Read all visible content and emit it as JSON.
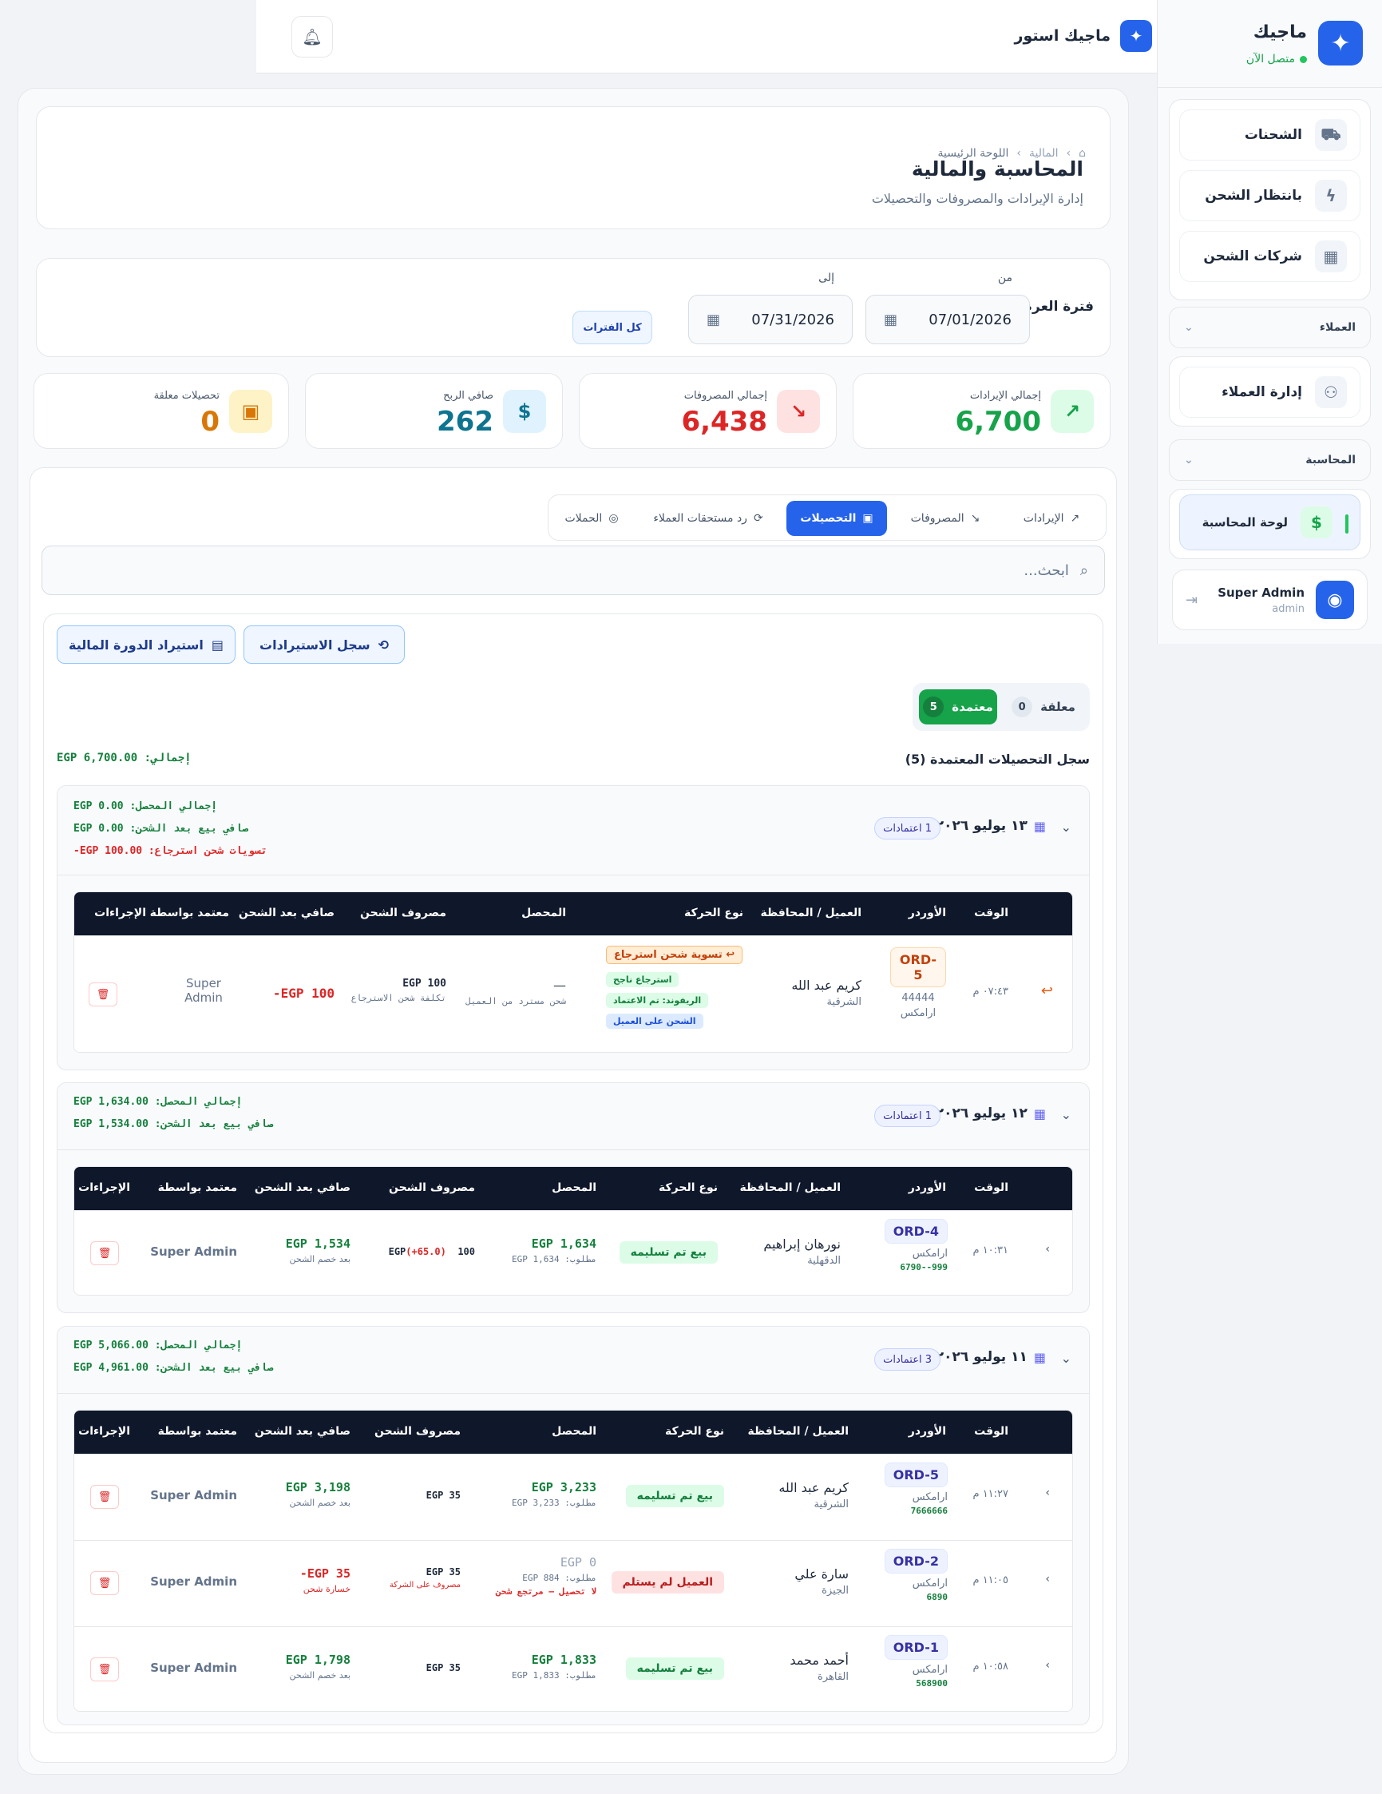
{
  "sidebar": {
    "brand": {
      "name": "ماجيك",
      "status": "متصل الآن"
    },
    "items": {
      "shipments": "الشحنات",
      "pending": "بانتظار الشحن",
      "carriers": "شركات الشحن",
      "clients_section": "العملاء",
      "clients_mgmt": "إدارة العملاء",
      "accounting_section": "المحاسبة",
      "accounting_dashboard": "لوحة المحاسبة"
    },
    "user": {
      "name": "Super Admin",
      "role": "admin"
    }
  },
  "topbar": {
    "store_name": "ماجيك استور"
  },
  "header": {
    "breadcrumb": {
      "home": "اللوحة الرئيسية",
      "current": "المالية"
    },
    "title": "المحاسبة والمالية",
    "subtitle": "إدارة الإيرادات والمصروفات والتحصيلات"
  },
  "filter": {
    "label": "فترة العرض",
    "from_label": "من",
    "to_label": "إلى",
    "from_value": "07/01/2026",
    "to_value": "07/31/2026",
    "all_button": "كل الفترات"
  },
  "stats": {
    "revenue": {
      "label": "إجمالي الإيرادات",
      "value": "6,700",
      "color": "#16a34a"
    },
    "expenses": {
      "label": "إجمالي المصروفات",
      "value": "6,438",
      "color": "#dc2626"
    },
    "profit": {
      "label": "صافي الربح",
      "value": "262",
      "color": "#0e7490"
    },
    "pending": {
      "label": "تحصيلات معلقة",
      "value": "0",
      "color": "#d97706"
    }
  },
  "tabs": {
    "revenues": "الإيرادات",
    "expenses": "المصروفات",
    "collections": "التحصيلات",
    "refunds": "رد مستحقات العملاء",
    "campaigns": "الحملات"
  },
  "search": {
    "placeholder": "ابحث..."
  },
  "collections": {
    "import_cycle": "استيراد الدورة المالية",
    "import_log": "سجل الاستيرادات",
    "seg_approved": "معتمدة",
    "seg_approved_count": "5",
    "seg_pending": "معلقة",
    "seg_pending_count": "0",
    "log_title": "سجل التحصيلات المعتمدة (5)",
    "log_total": "إجمالي: EGP 6,700.00"
  },
  "columns": {
    "time": "الوقت",
    "order": "الأوردر",
    "client": "العميل / المحافظة",
    "type": "نوع الحركة",
    "collected": "المحصل",
    "shipping": "مصروف الشحن",
    "net": "صافي بعد الشحن",
    "approved_by": "معتمد بواسطة",
    "actions": "الإجراءات"
  },
  "days": [
    {
      "date": "١٣ يوليو ٢٠٢٦",
      "badge": "1 اعتمادات",
      "sum1": "إجمالي المحصل: EGP 0.00",
      "sum2": "صافي بيع بعد الشحن: EGP 0.00",
      "sum3": "تسويات شحن استرجاع: EGP 100.00-",
      "rows": [
        {
          "time": "٠٧:٤٣ م",
          "order": "ORD-5",
          "ref": "44444",
          "carrier": "ارامكس",
          "client": "كريم عبد الله",
          "gov": "الشرقية",
          "type_main": "↩ تسوية شحن استرجاع",
          "tag1": "استرجاع ناجح",
          "tag2": "الريفوند: تم الاعتماد",
          "tag3": "الشحن على العميل",
          "collected": "—",
          "collected_sub": "شحن مسترد من العميل",
          "shipping": "EGP 100",
          "shipping_sub": "تكلفة شحن الاسترجاع",
          "net": "EGP 100-",
          "approved_by": "Super Admin"
        }
      ]
    },
    {
      "date": "١٢ يوليو ٢٠٢٦",
      "badge": "1 اعتمادات",
      "sum1": "إجمالي المحصل: EGP 1,634.00",
      "sum2": "صافي بيع بعد الشحن: EGP 1,534.00",
      "rows": [
        {
          "time": "١٠:٣١ م",
          "order": "ORD-4",
          "carrier": "ارامكس",
          "ref": "6790--999",
          "client": "نورهان إبراهيم",
          "gov": "الدقهلية",
          "type": "بيع تم تسليمه",
          "collected": "EGP 1,634",
          "collected_sub": "مطلوب: EGP 1,634",
          "shipping": "100",
          "shipping_extra": "(+65.0)",
          "shipping_cur": "EGP",
          "net": "EGP 1,534",
          "net_sub": "بعد خصم الشحن",
          "approved_by": "Super Admin"
        }
      ]
    },
    {
      "date": "١١ يوليو ٢٠٢٦",
      "badge": "3 اعتمادات",
      "sum1": "إجمالي المحصل: EGP 5,066.00",
      "sum2": "صافي بيع بعد الشحن: EGP 4,961.00",
      "rows": [
        {
          "time": "١١:٢٧ م",
          "order": "ORD-5",
          "carrier": "ارامكس",
          "ref": "7666666",
          "client": "كريم عبد الله",
          "gov": "الشرقية",
          "type": "بيع تم تسليمه",
          "collected": "EGP 3,233",
          "collected_sub": "مطلوب: EGP 3,233",
          "shipping": "EGP 35",
          "net": "EGP 3,198",
          "net_sub": "بعد خصم الشحن",
          "approved_by": "Super Admin"
        },
        {
          "time": "١١:٠٥ م",
          "order": "ORD-2",
          "carrier": "ارامكس",
          "ref": "6890",
          "client": "سارة علي",
          "gov": "الجيزة",
          "type": "العميل لم يستلم",
          "collected": "EGP 0",
          "collected_sub": "مطلوب: EGP 884",
          "collected_note": "لا تحصيل — مرتجع شحن",
          "shipping": "EGP 35",
          "shipping_sub": "مصروف على الشركة",
          "net": "EGP 35-",
          "net_sub": "خسارة شحن",
          "approved_by": "Super Admin"
        },
        {
          "time": "١٠:٥٨ م",
          "order": "ORD-1",
          "carrier": "ارامكس",
          "ref": "568900",
          "client": "أحمد محمد",
          "gov": "القاهرة",
          "type": "بيع تم تسليمه",
          "collected": "EGP 1,833",
          "collected_sub": "مطلوب: EGP 1,833",
          "shipping": "EGP 35",
          "net": "EGP 1,798",
          "net_sub": "بعد خصم الشحن",
          "approved_by": "Super Admin"
        }
      ]
    }
  ]
}
